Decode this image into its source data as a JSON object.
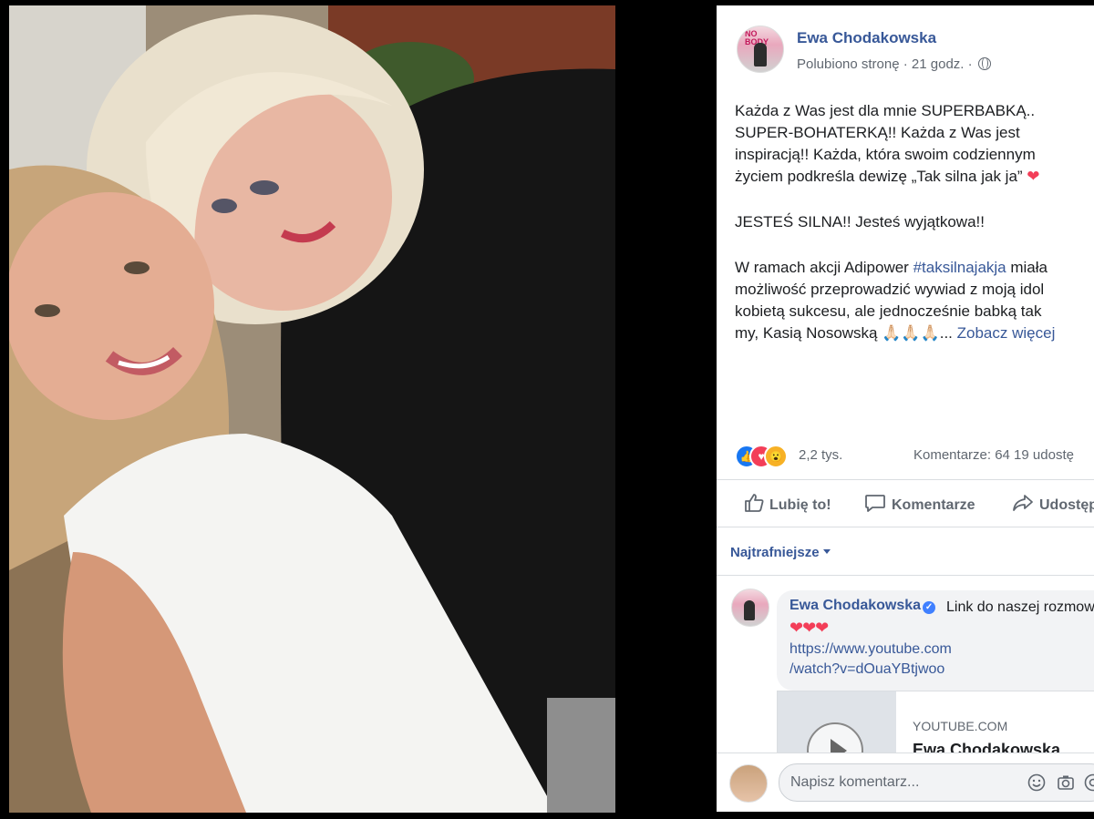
{
  "post": {
    "author": "Ewa Chodakowska",
    "meta": "Polubiono stronę · 21 godz. ·",
    "paragraphs": {
      "p1_line1": "Każda z Was jest dla mnie SUPERBABKĄ..",
      "p1_line2": "SUPER-BOHATERKĄ!! Każda z Was jest",
      "p1_line3": "inspiracją!! Każda, która swoim codziennym",
      "p1_line4": "życiem podkreśla dewizę „Tak silna jak ja”",
      "p2": "JESTEŚ SILNA!! Jesteś wyjątkowa!!",
      "p3_prefix": "W ramach akcji Adipower ",
      "p3_hashtag": "#taksilnajakja",
      "p3_suffix": " miała",
      "p3_line2": "możliwość przeprowadzić wywiad z moją idol",
      "p3_line3": "kobietą sukcesu, ale jednocześnie babką tak",
      "p3_line4": "my, Kasią Nosowską 🙏🏻🙏🏻🙏🏻... ",
      "see_more": "Zobacz więcej"
    },
    "reactions_count": "2,2 tys.",
    "stats": "Komentarze: 64   19 udostę"
  },
  "actions": {
    "like": "Lubię to!",
    "comment": "Komentarze",
    "share": "Udostępnij"
  },
  "sort_label": "Najtrafniejsze",
  "comment": {
    "author": "Ewa Chodakowska",
    "text": "Link do naszej rozmowy",
    "hearts": "❤❤❤",
    "link_line1": "https://www.youtube.com",
    "link_line2": "/watch?v=dOuaYBtjwoo",
    "card_domain": "YOUTUBE.COM",
    "card_title": "Ewa Chodakowska"
  },
  "write_comment": {
    "placeholder": "Napisz komentarz..."
  },
  "colors": {
    "link": "#385898",
    "like_blue": "#1877f2",
    "love_red": "#f33e58",
    "wow_yellow": "#f7b125"
  }
}
